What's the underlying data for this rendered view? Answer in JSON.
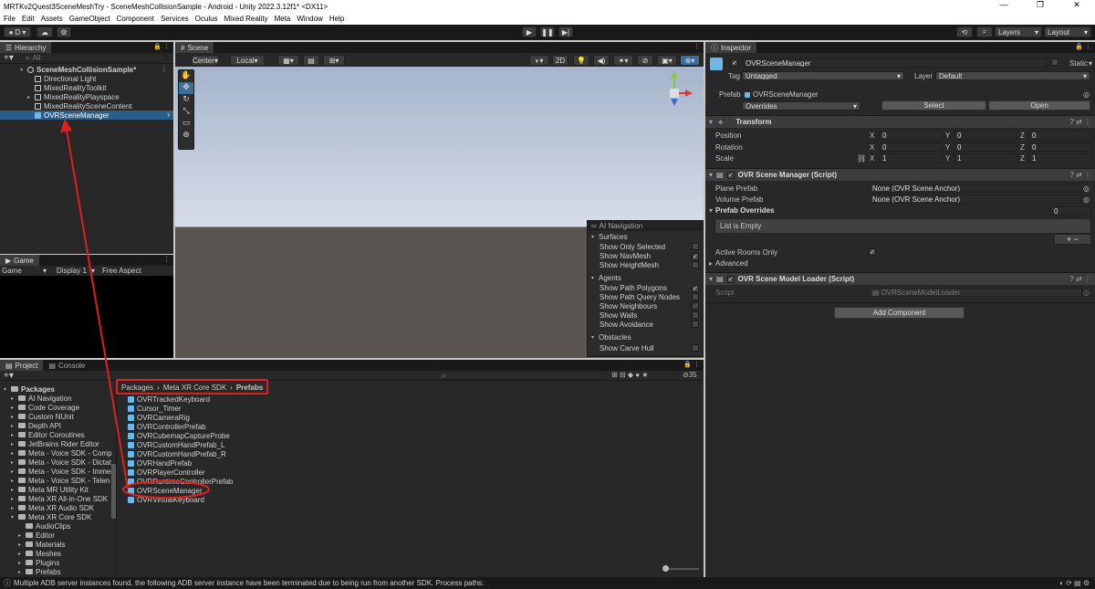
{
  "window": {
    "title": "MRTKv2Quest3SceneMeshTry - SceneMeshCollisionSample - Android - Unity 2022.3.12f1* <DX11>",
    "controls": [
      "—",
      "❐",
      "✕"
    ]
  },
  "menu": [
    "File",
    "Edit",
    "Assets",
    "GameObject",
    "Component",
    "Services",
    "Oculus",
    "Mixed Reality",
    "Meta",
    "Window",
    "Help"
  ],
  "toolbar": {
    "account": "D",
    "layers": "Layers",
    "layout": "Layout"
  },
  "hierarchy": {
    "tab": "Hierarchy",
    "search_placeholder": "All",
    "scene": "SceneMeshCollisionSample*",
    "items": [
      "Directional Light",
      "MixedRealityToolkit",
      "MixedRealityPlayspace",
      "MixedRealitySceneContent",
      "OVRSceneManager"
    ]
  },
  "scene": {
    "tab": "Scene",
    "pivot": "Center",
    "space": "Local",
    "mode_2d": "2D"
  },
  "ai_nav": {
    "title": "AI Navigation",
    "surfaces": "Surfaces",
    "surface_items": [
      "Show Only Selected",
      "Show NavMesh",
      "Show HeightMesh"
    ],
    "agents": "Agents",
    "agent_items": [
      "Show Path Polygons",
      "Show Path Query Nodes",
      "Show Neighbours",
      "Show Walls",
      "Show Avoidance"
    ],
    "obstacles": "Obstacles",
    "obstacle_items": [
      "Show Carve Hull"
    ]
  },
  "game": {
    "tab": "Game",
    "mode": "Game",
    "display": "Display 1",
    "aspect": "Free Aspect"
  },
  "project": {
    "tabs": [
      "Project",
      "Console"
    ],
    "tree_root": "Packages",
    "tree": [
      "AI Navigation",
      "Code Coverage",
      "Custom NUnit",
      "Depth API",
      "Editor Coroutines",
      "JetBrains Rider Editor",
      "Meta - Voice SDK - Comp",
      "Meta - Voice SDK - Dictat",
      "Meta - Voice SDK - Immer",
      "Meta - Voice SDK - Telen",
      "Meta MR Utility Kit",
      "Meta XR All-in-One SDK",
      "Meta XR Audio SDK",
      "Meta XR Core SDK"
    ],
    "tree_children": [
      "AudioClips",
      "Editor",
      "Materials",
      "Meshes",
      "Plugins",
      "Prefabs"
    ],
    "breadcrumb": [
      "Packages",
      "Meta XR Core SDK",
      "Prefabs"
    ],
    "files": [
      "OVRTrackedKeyboard",
      "Cursor_Timer",
      "OVRCameraRig",
      "OVRControllerPrefab",
      "OVRCubemapCaptureProbe",
      "OVRCustomHandPrefab_L",
      "OVRCustomHandPrefab_R",
      "OVRHandPrefab",
      "OVRPlayerController",
      "OVRRuntimeControllerPrefab",
      "OVRSceneManager",
      "OVRVirtualKeyboard"
    ],
    "count": "35"
  },
  "inspector": {
    "tab": "Inspector",
    "object_name": "OVRSceneManager",
    "static": "Static",
    "tag_label": "Tag",
    "tag": "Untagged",
    "layer_label": "Layer",
    "layer": "Default",
    "prefab_label": "Prefab",
    "prefab": "OVRSceneManager",
    "overrides": "Overrides",
    "select": "Select",
    "open": "Open",
    "transform": {
      "title": "Transform",
      "position": "Position",
      "rotation": "Rotation",
      "scale": "Scale",
      "pos": [
        "0",
        "0",
        "0"
      ],
      "rot": [
        "0",
        "0",
        "0"
      ],
      "scl": [
        "1",
        "1",
        "1"
      ]
    },
    "scene_manager": {
      "title": "OVR Scene Manager (Script)",
      "plane_label": "Plane Prefab",
      "plane_value": "None (OVR Scene Anchor)",
      "volume_label": "Volume Prefab",
      "volume_value": "None (OVR Scene Anchor)",
      "overrides_label": "Prefab Overrides",
      "overrides_count": "0",
      "list_empty": "List is Empty",
      "active_rooms": "Active Rooms Only",
      "advanced": "Advanced"
    },
    "model_loader": {
      "title": "OVR Scene Model Loader (Script)",
      "script_label": "Script",
      "script_value": "OVRSceneModelLoader"
    },
    "add_component": "Add Component"
  },
  "status": "Multiple ADB server instances found, the following ADB server instance have been terminated due to being run from another SDK. Process paths:",
  "colors": {
    "annotation": "#e02020",
    "selection": "#2c5d87",
    "sky": "#c9d3e3",
    "ground": "#5a5550"
  }
}
